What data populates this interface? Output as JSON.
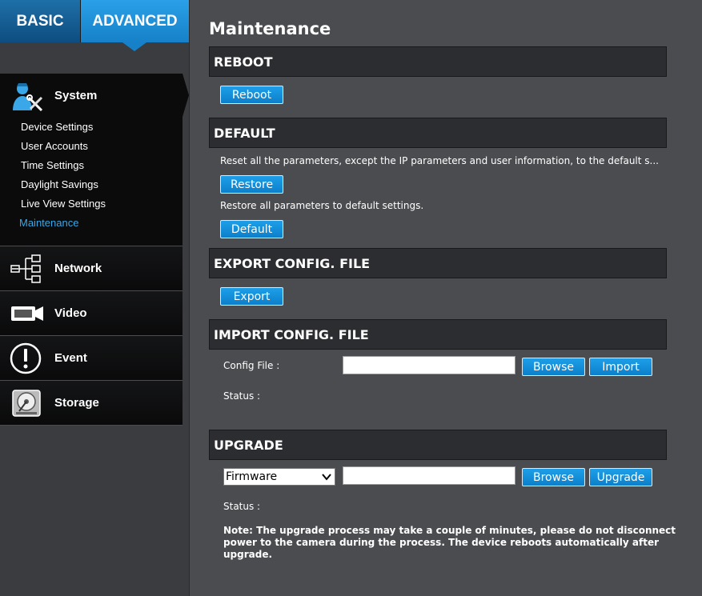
{
  "topnav": {
    "basic_label": "BASIC",
    "advanced_label": "ADVANCED"
  },
  "sidebar": {
    "system": {
      "label": "System",
      "items": [
        "Device Settings",
        "User Accounts",
        "Time Settings",
        "Daylight Savings",
        "Live View Settings",
        "Maintenance"
      ]
    },
    "network": {
      "label": "Network"
    },
    "video": {
      "label": "Video"
    },
    "event": {
      "label": "Event"
    },
    "storage": {
      "label": "Storage"
    }
  },
  "main": {
    "title": "Maintenance",
    "reboot": {
      "header": "REBOOT",
      "button": "Reboot"
    },
    "default": {
      "header": "DEFAULT",
      "restore_desc": "Reset all the parameters, except the IP parameters and user information, to the default s...",
      "restore_button": "Restore",
      "default_desc": "Restore all parameters to default settings.",
      "default_button": "Default"
    },
    "export": {
      "header": "EXPORT CONFIG. FILE",
      "button": "Export"
    },
    "import": {
      "header": "IMPORT CONFIG. FILE",
      "config_label": "Config File :",
      "config_value": "",
      "browse_button": "Browse",
      "import_button": "Import",
      "status_label": "Status :"
    },
    "upgrade": {
      "header": "UPGRADE",
      "select_value": "Firmware",
      "file_value": "",
      "browse_button": "Browse",
      "upgrade_button": "Upgrade",
      "status_label": "Status :",
      "note": "Note: The upgrade process may take a couple of minutes, please do not disconnect power to the camera during the process. The device reboots automatically after upgrade."
    }
  },
  "colors": {
    "accent": "#1681c8",
    "active_link": "#3aa7e8",
    "section_bar": "#2c2d30",
    "background": "#4a4c50"
  }
}
